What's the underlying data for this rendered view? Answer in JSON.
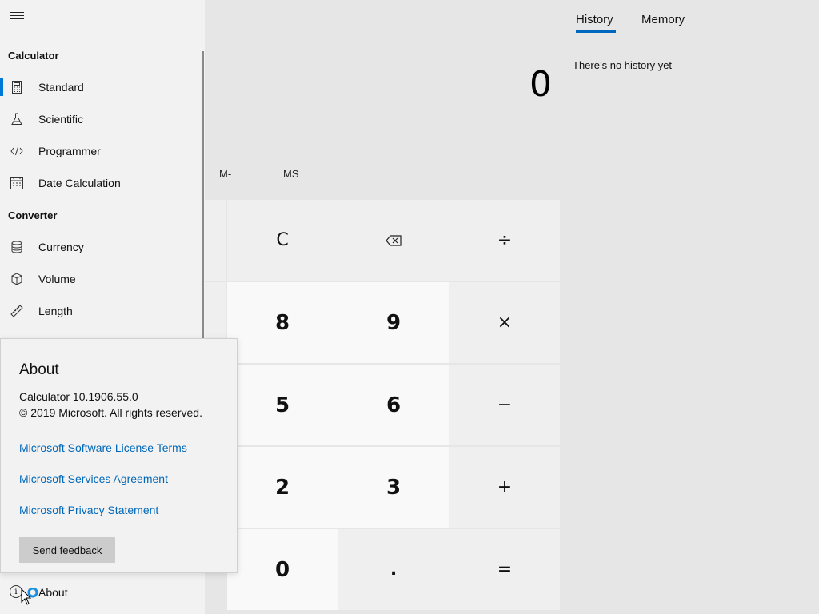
{
  "display": {
    "value": "0"
  },
  "memory": {
    "buttons": [
      "M-",
      "MS"
    ]
  },
  "keys": [
    {
      "label": "C",
      "kind": "op"
    },
    {
      "label": "⌫",
      "kind": "op"
    },
    {
      "label": "÷",
      "kind": "op"
    },
    {
      "label": "8",
      "kind": "num"
    },
    {
      "label": "9",
      "kind": "num"
    },
    {
      "label": "×",
      "kind": "op"
    },
    {
      "label": "5",
      "kind": "num"
    },
    {
      "label": "6",
      "kind": "num"
    },
    {
      "label": "−",
      "kind": "op"
    },
    {
      "label": "2",
      "kind": "num"
    },
    {
      "label": "3",
      "kind": "num"
    },
    {
      "label": "+",
      "kind": "op"
    },
    {
      "label": "0",
      "kind": "num"
    },
    {
      "label": ".",
      "kind": "op"
    },
    {
      "label": "=",
      "kind": "op"
    }
  ],
  "history": {
    "tabs": [
      "History",
      "Memory"
    ],
    "active_tab": "History",
    "empty_text": "There’s no history yet"
  },
  "nav": {
    "sections": [
      {
        "title": "Calculator",
        "items": [
          {
            "label": "Standard",
            "icon": "calculator-icon",
            "active": true
          },
          {
            "label": "Scientific",
            "icon": "flask-icon"
          },
          {
            "label": "Programmer",
            "icon": "code-icon"
          },
          {
            "label": "Date Calculation",
            "icon": "calendar-icon"
          }
        ]
      },
      {
        "title": "Converter",
        "items": [
          {
            "label": "Currency",
            "icon": "coins-icon"
          },
          {
            "label": "Volume",
            "icon": "cube-icon"
          },
          {
            "label": "Length",
            "icon": "ruler-icon"
          }
        ]
      }
    ],
    "about_label": "About",
    "accent": "#0078d7"
  },
  "about": {
    "title": "About",
    "version": "Calculator 10.1906.55.0",
    "copyright": "© 2019 Microsoft. All rights reserved.",
    "links": [
      "Microsoft Software License Terms",
      "Microsoft Services Agreement",
      "Microsoft Privacy Statement"
    ],
    "feedback_label": "Send feedback",
    "link_color": "#0067b8"
  }
}
